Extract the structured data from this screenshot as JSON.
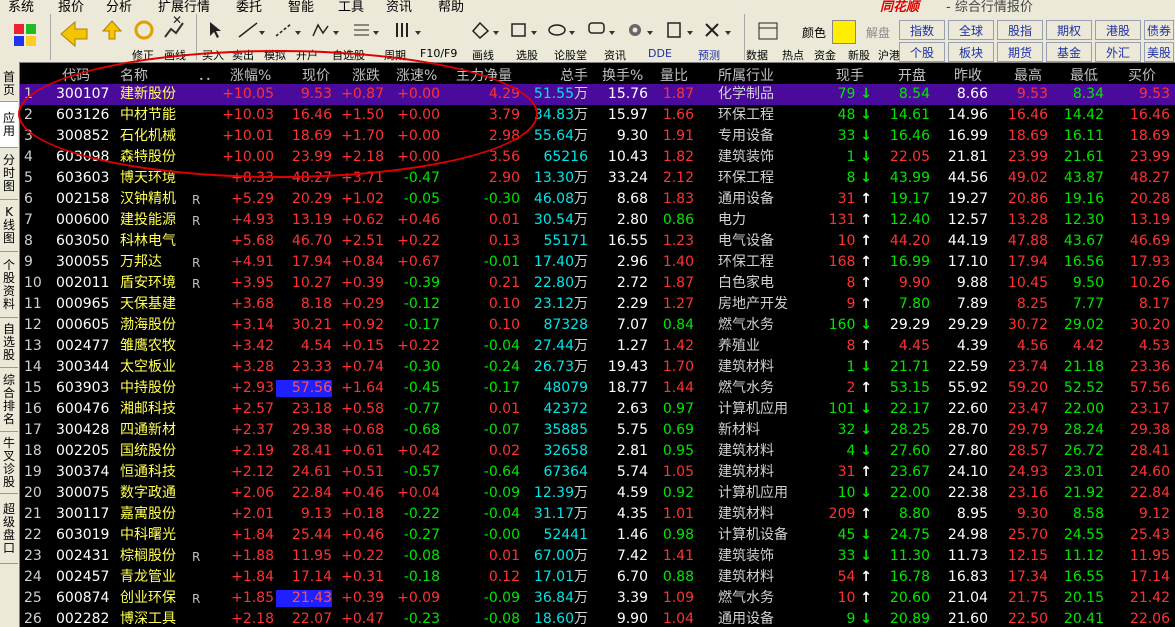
{
  "menu": [
    "系统",
    "报价",
    "分析",
    "扩展行情",
    "委托",
    "智能",
    "工具",
    "资讯",
    "帮助"
  ],
  "brand": "同花顺",
  "window_title": "- 综合行情报价",
  "toolbar": {
    "labels": [
      "修正",
      "画线",
      "买入",
      "卖出",
      "模拟",
      "开户",
      "自选股",
      "周期",
      "F10/F9",
      "画线",
      "选股",
      "论股堂",
      "资讯",
      "DDE",
      "预测",
      "数据",
      "热点",
      "资金",
      "新股",
      "沪港通"
    ],
    "color_label": "颜色",
    "right_text": "解盘"
  },
  "right_buttons": [
    "指数",
    "全球",
    "股指",
    "期权",
    "港股",
    "债券",
    "个股",
    "板块",
    "期货",
    "基金",
    "外汇",
    "美股"
  ],
  "sidebar_tabs": [
    "首页",
    "应用",
    "分时图",
    "K线图",
    "个股资料",
    "自选股",
    "综合排名",
    "牛叉诊股",
    "超级盘口"
  ],
  "columns": [
    "代码",
    "名称",
    "．．",
    "涨幅%",
    "现价",
    "涨跌",
    "涨速%",
    "主力净量",
    "总手",
    "换手%",
    "量比",
    "所属行业",
    "现手",
    "开盘",
    "昨收",
    "最高",
    "最低",
    "买价"
  ],
  "rows": [
    {
      "n": "1",
      "code": "300107",
      "name": "建新股份",
      "r": "",
      "chg": "+10.05",
      "price": "9.53",
      "diff": "+0.87",
      "spd": "+0.00",
      "main": "4.29",
      "vol": "51.55",
      "volu": "万",
      "turn": "15.76",
      "qr": "1.87",
      "ind": "化学制品",
      "hand": "79",
      "dir": "down",
      "open": "8.54",
      "prev": "8.66",
      "high": "9.53",
      "low": "8.34",
      "bid": "9.53"
    },
    {
      "n": "2",
      "code": "603126",
      "name": "中材节能",
      "r": "",
      "chg": "+10.03",
      "price": "16.46",
      "diff": "+1.50",
      "spd": "+0.00",
      "main": "3.79",
      "vol": "34.83",
      "volu": "万",
      "turn": "15.97",
      "qr": "1.66",
      "ind": "环保工程",
      "hand": "48",
      "dir": "down",
      "open": "14.61",
      "prev": "14.96",
      "high": "16.46",
      "low": "14.42",
      "bid": "16.46"
    },
    {
      "n": "3",
      "code": "300852",
      "name": "石化机械",
      "r": "",
      "chg": "+10.01",
      "price": "18.69",
      "diff": "+1.70",
      "spd": "+0.00",
      "main": "2.98",
      "vol": "55.64",
      "volu": "万",
      "turn": "9.30",
      "qr": "1.91",
      "ind": "专用设备",
      "hand": "33",
      "dir": "down",
      "open": "16.46",
      "prev": "16.99",
      "high": "18.69",
      "low": "16.11",
      "bid": "18.69"
    },
    {
      "n": "4",
      "code": "603098",
      "name": "森特股份",
      "r": "",
      "chg": "+10.00",
      "price": "23.99",
      "diff": "+2.18",
      "spd": "+0.00",
      "main": "3.56",
      "vol": "65216",
      "volu": "",
      "turn": "10.43",
      "qr": "1.82",
      "ind": "建筑装饰",
      "hand": "1",
      "dir": "down",
      "open": "22.05",
      "prev": "21.81",
      "high": "23.99",
      "low": "21.61",
      "bid": "23.99"
    },
    {
      "n": "5",
      "code": "603603",
      "name": "博天环境",
      "r": "",
      "chg": "+8.33",
      "price": "48.27",
      "diff": "+3.71",
      "spd": "-0.47",
      "main": "2.90",
      "vol": "13.30",
      "volu": "万",
      "turn": "33.24",
      "qr": "2.12",
      "ind": "环保工程",
      "hand": "8",
      "dir": "down",
      "open": "43.99",
      "prev": "44.56",
      "high": "49.02",
      "low": "43.87",
      "bid": "48.27"
    },
    {
      "n": "6",
      "code": "002158",
      "name": "汉钟精机",
      "r": "R",
      "chg": "+5.29",
      "price": "20.29",
      "diff": "+1.02",
      "spd": "-0.05",
      "main": "-0.30",
      "vol": "46.08",
      "volu": "万",
      "turn": "8.68",
      "qr": "1.83",
      "ind": "通用设备",
      "hand": "31",
      "dir": "up",
      "open": "19.17",
      "prev": "19.27",
      "high": "20.86",
      "low": "19.16",
      "bid": "20.28"
    },
    {
      "n": "7",
      "code": "000600",
      "name": "建投能源",
      "r": "R",
      "chg": "+4.93",
      "price": "13.19",
      "diff": "+0.62",
      "spd": "+0.46",
      "main": "0.01",
      "vol": "30.54",
      "volu": "万",
      "turn": "2.80",
      "qr": "0.86",
      "ind": "电力",
      "hand": "131",
      "dir": "up",
      "open": "12.40",
      "prev": "12.57",
      "high": "13.28",
      "low": "12.30",
      "bid": "13.19"
    },
    {
      "n": "8",
      "code": "603050",
      "name": "科林电气",
      "r": "",
      "chg": "+5.68",
      "price": "46.70",
      "diff": "+2.51",
      "spd": "+0.22",
      "main": "0.13",
      "vol": "55171",
      "volu": "",
      "turn": "16.55",
      "qr": "1.23",
      "ind": "电气设备",
      "hand": "10",
      "dir": "up",
      "open": "44.20",
      "prev": "44.19",
      "high": "47.88",
      "low": "43.67",
      "bid": "46.69"
    },
    {
      "n": "9",
      "code": "300055",
      "name": "万邦达",
      "r": "R",
      "chg": "+4.91",
      "price": "17.94",
      "diff": "+0.84",
      "spd": "+0.67",
      "main": "-0.01",
      "vol": "17.40",
      "volu": "万",
      "turn": "2.96",
      "qr": "1.40",
      "ind": "环保工程",
      "hand": "168",
      "dir": "up",
      "open": "16.99",
      "prev": "17.10",
      "high": "17.94",
      "low": "16.56",
      "bid": "17.93"
    },
    {
      "n": "10",
      "code": "002011",
      "name": "盾安环境",
      "r": "R",
      "chg": "+3.95",
      "price": "10.27",
      "diff": "+0.39",
      "spd": "-0.39",
      "main": "0.21",
      "vol": "22.80",
      "volu": "万",
      "turn": "2.72",
      "qr": "1.87",
      "ind": "白色家电",
      "hand": "8",
      "dir": "up",
      "open": "9.90",
      "prev": "9.88",
      "high": "10.45",
      "low": "9.50",
      "bid": "10.26"
    },
    {
      "n": "11",
      "code": "000965",
      "name": "天保基建",
      "r": "",
      "chg": "+3.68",
      "price": "8.18",
      "diff": "+0.29",
      "spd": "-0.12",
      "main": "0.10",
      "vol": "23.12",
      "volu": "万",
      "turn": "2.29",
      "qr": "1.27",
      "ind": "房地产开发",
      "hand": "9",
      "dir": "up",
      "open": "7.80",
      "prev": "7.89",
      "high": "8.25",
      "low": "7.77",
      "bid": "8.17"
    },
    {
      "n": "12",
      "code": "000605",
      "name": "渤海股份",
      "r": "",
      "chg": "+3.14",
      "price": "30.21",
      "diff": "+0.92",
      "spd": "-0.17",
      "main": "0.10",
      "vol": "87328",
      "volu": "",
      "turn": "7.07",
      "qr": "0.84",
      "ind": "燃气水务",
      "hand": "160",
      "dir": "down",
      "open": "29.29",
      "prev": "29.29",
      "high": "30.72",
      "low": "29.02",
      "bid": "30.20"
    },
    {
      "n": "13",
      "code": "002477",
      "name": "雏鹰农牧",
      "r": "",
      "chg": "+3.42",
      "price": "4.54",
      "diff": "+0.15",
      "spd": "+0.22",
      "main": "-0.04",
      "vol": "27.44",
      "volu": "万",
      "turn": "1.27",
      "qr": "1.42",
      "ind": "养殖业",
      "hand": "8",
      "dir": "up",
      "open": "4.45",
      "prev": "4.39",
      "high": "4.56",
      "low": "4.42",
      "bid": "4.53"
    },
    {
      "n": "14",
      "code": "300344",
      "name": "太空板业",
      "r": "",
      "chg": "+3.28",
      "price": "23.33",
      "diff": "+0.74",
      "spd": "-0.30",
      "main": "-0.24",
      "vol": "26.73",
      "volu": "万",
      "turn": "19.43",
      "qr": "1.70",
      "ind": "建筑材料",
      "hand": "1",
      "dir": "down",
      "open": "21.71",
      "prev": "22.59",
      "high": "23.74",
      "low": "21.18",
      "bid": "23.36"
    },
    {
      "n": "15",
      "code": "603903",
      "name": "中持股份",
      "r": "",
      "chg": "+2.93",
      "price": "57.56",
      "diff": "+1.64",
      "spd": "-0.45",
      "main": "-0.17",
      "vol": "48079",
      "volu": "",
      "turn": "18.77",
      "qr": "1.44",
      "ind": "燃气水务",
      "hand": "2",
      "dir": "up",
      "open": "53.15",
      "prev": "55.92",
      "high": "59.20",
      "low": "52.52",
      "bid": "57.56",
      "hl": true
    },
    {
      "n": "16",
      "code": "600476",
      "name": "湘邮科技",
      "r": "",
      "chg": "+2.57",
      "price": "23.18",
      "diff": "+0.58",
      "spd": "-0.77",
      "main": "0.01",
      "vol": "42372",
      "volu": "",
      "turn": "2.63",
      "qr": "0.97",
      "ind": "计算机应用",
      "hand": "101",
      "dir": "down",
      "open": "22.17",
      "prev": "22.60",
      "high": "23.47",
      "low": "22.00",
      "bid": "23.17"
    },
    {
      "n": "17",
      "code": "300428",
      "name": "四通新材",
      "r": "",
      "chg": "+2.37",
      "price": "29.38",
      "diff": "+0.68",
      "spd": "-0.68",
      "main": "-0.07",
      "vol": "35885",
      "volu": "",
      "turn": "5.75",
      "qr": "0.69",
      "ind": "新材料",
      "hand": "32",
      "dir": "down",
      "open": "28.25",
      "prev": "28.70",
      "high": "29.79",
      "low": "28.24",
      "bid": "29.38"
    },
    {
      "n": "18",
      "code": "002205",
      "name": "国统股份",
      "r": "",
      "chg": "+2.19",
      "price": "28.41",
      "diff": "+0.61",
      "spd": "+0.42",
      "main": "0.02",
      "vol": "32658",
      "volu": "",
      "turn": "2.81",
      "qr": "0.95",
      "ind": "建筑材料",
      "hand": "4",
      "dir": "down",
      "open": "27.60",
      "prev": "27.80",
      "high": "28.57",
      "low": "26.72",
      "bid": "28.41"
    },
    {
      "n": "19",
      "code": "300374",
      "name": "恒通科技",
      "r": "",
      "chg": "+2.12",
      "price": "24.61",
      "diff": "+0.51",
      "spd": "-0.57",
      "main": "-0.64",
      "vol": "67364",
      "volu": "",
      "turn": "5.74",
      "qr": "1.05",
      "ind": "建筑材料",
      "hand": "31",
      "dir": "up",
      "open": "23.67",
      "prev": "24.10",
      "high": "24.93",
      "low": "23.01",
      "bid": "24.60"
    },
    {
      "n": "20",
      "code": "300075",
      "name": "数字政通",
      "r": "",
      "chg": "+2.06",
      "price": "22.84",
      "diff": "+0.46",
      "spd": "+0.04",
      "main": "-0.09",
      "vol": "12.39",
      "volu": "万",
      "turn": "4.59",
      "qr": "0.92",
      "ind": "计算机应用",
      "hand": "10",
      "dir": "down",
      "open": "22.00",
      "prev": "22.38",
      "high": "23.16",
      "low": "21.92",
      "bid": "22.84"
    },
    {
      "n": "21",
      "code": "300117",
      "name": "嘉寓股份",
      "r": "",
      "chg": "+2.01",
      "price": "9.13",
      "diff": "+0.18",
      "spd": "-0.22",
      "main": "-0.04",
      "vol": "31.17",
      "volu": "万",
      "turn": "4.35",
      "qr": "1.01",
      "ind": "建筑材料",
      "hand": "209",
      "dir": "up",
      "open": "8.80",
      "prev": "8.95",
      "high": "9.30",
      "low": "8.58",
      "bid": "9.12"
    },
    {
      "n": "22",
      "code": "603019",
      "name": "中科曙光",
      "r": "",
      "chg": "+1.84",
      "price": "25.44",
      "diff": "+0.46",
      "spd": "-0.27",
      "main": "-0.00",
      "vol": "52441",
      "volu": "",
      "turn": "1.46",
      "qr": "0.98",
      "ind": "计算机设备",
      "hand": "45",
      "dir": "down",
      "open": "24.75",
      "prev": "24.98",
      "high": "25.70",
      "low": "24.55",
      "bid": "25.43"
    },
    {
      "n": "23",
      "code": "002431",
      "name": "棕榈股份",
      "r": "R",
      "chg": "+1.88",
      "price": "11.95",
      "diff": "+0.22",
      "spd": "-0.08",
      "main": "0.01",
      "vol": "67.00",
      "volu": "万",
      "turn": "7.42",
      "qr": "1.41",
      "ind": "建筑装饰",
      "hand": "33",
      "dir": "down",
      "open": "11.30",
      "prev": "11.73",
      "high": "12.15",
      "low": "11.12",
      "bid": "11.95"
    },
    {
      "n": "24",
      "code": "002457",
      "name": "青龙管业",
      "r": "",
      "chg": "+1.84",
      "price": "17.14",
      "diff": "+0.31",
      "spd": "-0.18",
      "main": "0.12",
      "vol": "17.01",
      "volu": "万",
      "turn": "6.70",
      "qr": "0.88",
      "ind": "建筑材料",
      "hand": "54",
      "dir": "up",
      "open": "16.78",
      "prev": "16.83",
      "high": "17.34",
      "low": "16.55",
      "bid": "17.14"
    },
    {
      "n": "25",
      "code": "600874",
      "name": "创业环保",
      "r": "R",
      "chg": "+1.85",
      "price": "21.43",
      "diff": "+0.39",
      "spd": "+0.09",
      "main": "-0.09",
      "vol": "36.84",
      "volu": "万",
      "turn": "3.39",
      "qr": "1.09",
      "ind": "燃气水务",
      "hand": "10",
      "dir": "up",
      "open": "20.60",
      "prev": "21.04",
      "high": "21.75",
      "low": "20.15",
      "bid": "21.42",
      "hl": true
    },
    {
      "n": "26",
      "code": "002282",
      "name": "博深工具",
      "r": "",
      "chg": "+2.18",
      "price": "22.07",
      "diff": "+0.47",
      "spd": "-0.23",
      "main": "-0.08",
      "vol": "18.60",
      "volu": "万",
      "turn": "9.90",
      "qr": "1.04",
      "ind": "通用设备",
      "hand": "9",
      "dir": "down",
      "open": "20.89",
      "prev": "21.60",
      "high": "22.50",
      "low": "20.41",
      "bid": "22.06"
    }
  ],
  "colors": {
    "up": "#ff3232",
    "down": "#00e600",
    "selected_row": "#4a0b9c",
    "highlight": "#2020ff",
    "annotation": "#e00000"
  }
}
